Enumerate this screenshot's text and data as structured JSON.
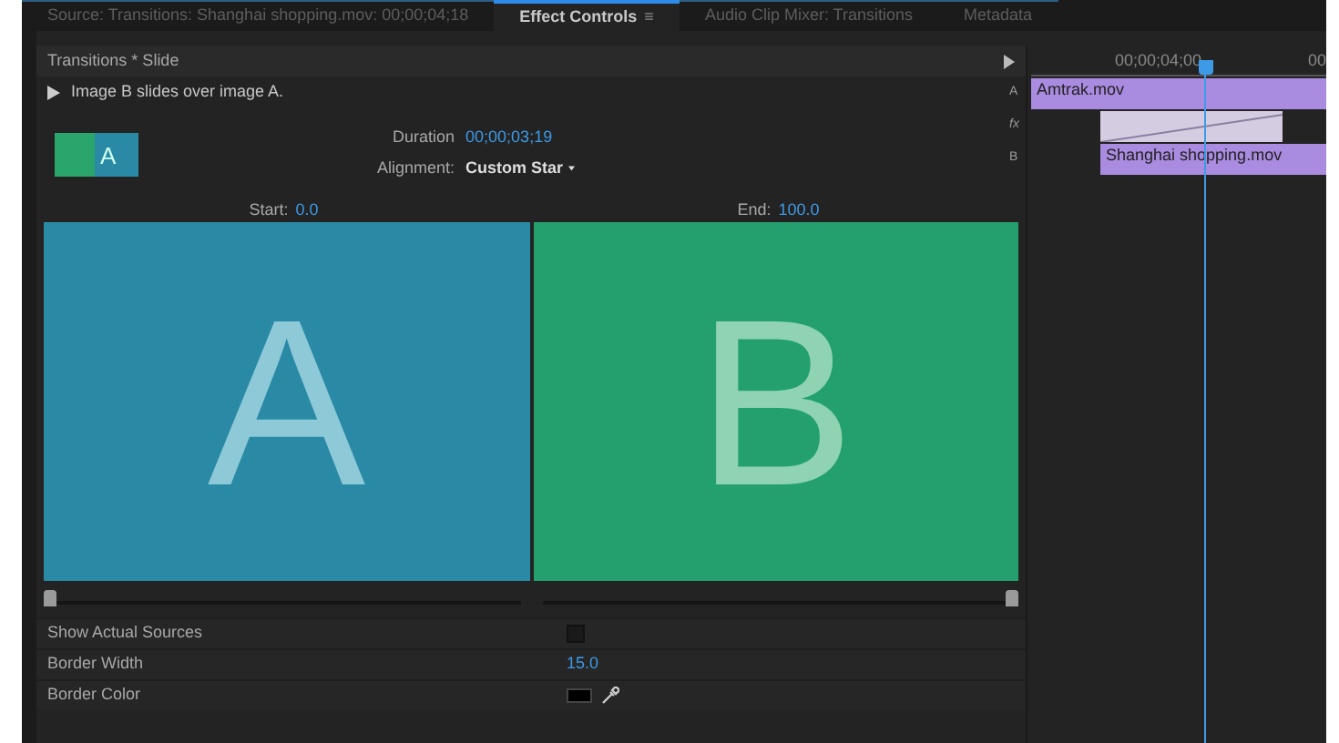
{
  "tabs": [
    {
      "label": "Source: Transitions: Shanghai shopping.mov: 00;00;04;18",
      "selected": false
    },
    {
      "label": "Effect Controls",
      "selected": true,
      "menu": "≡"
    },
    {
      "label": "Audio Clip Mixer: Transitions",
      "selected": false
    },
    {
      "label": "Metadata",
      "selected": false
    }
  ],
  "effect": {
    "title": "Transitions * Slide",
    "description": "Image B slides over image A.",
    "thumbnail_letter": "A",
    "duration_label": "Duration",
    "duration": "00;00;03;19",
    "alignment_label": "Alignment:",
    "alignment": "Custom Star"
  },
  "preview": {
    "start_label": "Start:",
    "start": "0.0",
    "end_label": "End:",
    "end": "100.0",
    "letter_a": "A",
    "letter_b": "B",
    "start_slider": {
      "level": 0
    },
    "end_slider": {
      "level": 1
    }
  },
  "properties": [
    {
      "kind": "checkbox",
      "label": "Show Actual Sources",
      "checked": false
    },
    {
      "kind": "number",
      "label": "Border Width",
      "value": "15.0"
    },
    {
      "kind": "color",
      "label": "Border Color",
      "color": "#000000"
    }
  ],
  "timeline": {
    "time": "00;00;04;00",
    "time_cut": "00",
    "tracks": [
      {
        "label": "A",
        "clip": "Amtrak.mov"
      },
      {
        "label": "fx"
      },
      {
        "label": "B",
        "clip": "Shanghai shopping.mov"
      }
    ]
  }
}
